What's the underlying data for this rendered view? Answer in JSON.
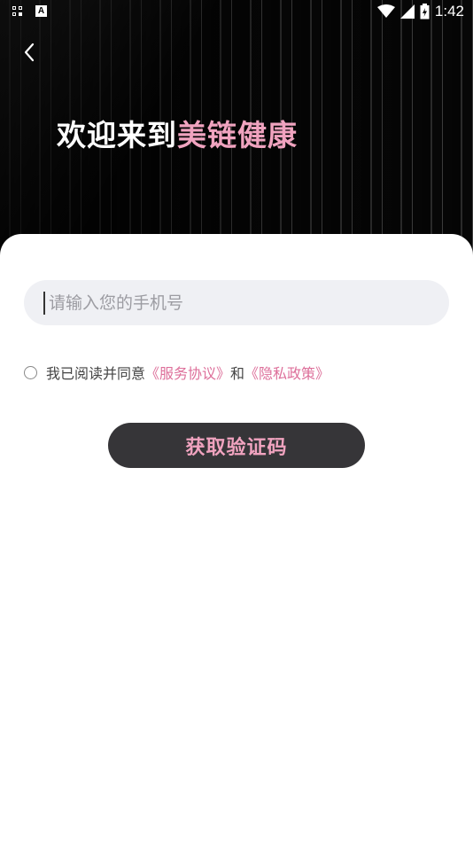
{
  "status_bar": {
    "time": "1:42",
    "left_icons": [
      "qr-grid-icon",
      "keyboard-a-icon"
    ],
    "right_icons": [
      "wifi-icon",
      "signal-icon",
      "battery-icon"
    ],
    "a_glyph": "A"
  },
  "header": {
    "back_icon": "chevron-left-icon",
    "welcome_prefix": "欢迎来到",
    "brand_name": "美链健康"
  },
  "form": {
    "phone_placeholder": "请输入您的手机号",
    "phone_value": ""
  },
  "agreement": {
    "prefix": "我已阅读并同意",
    "service_link": "《服务协议》",
    "joiner": "和",
    "privacy_link": "《隐私政策》",
    "checked": false
  },
  "actions": {
    "get_code_label": "获取验证码"
  },
  "colors": {
    "brand_pink": "#f0a3bf",
    "link_pink": "#dd6f9a",
    "button_dark": "#363538",
    "input_bg": "#eff0f4"
  }
}
